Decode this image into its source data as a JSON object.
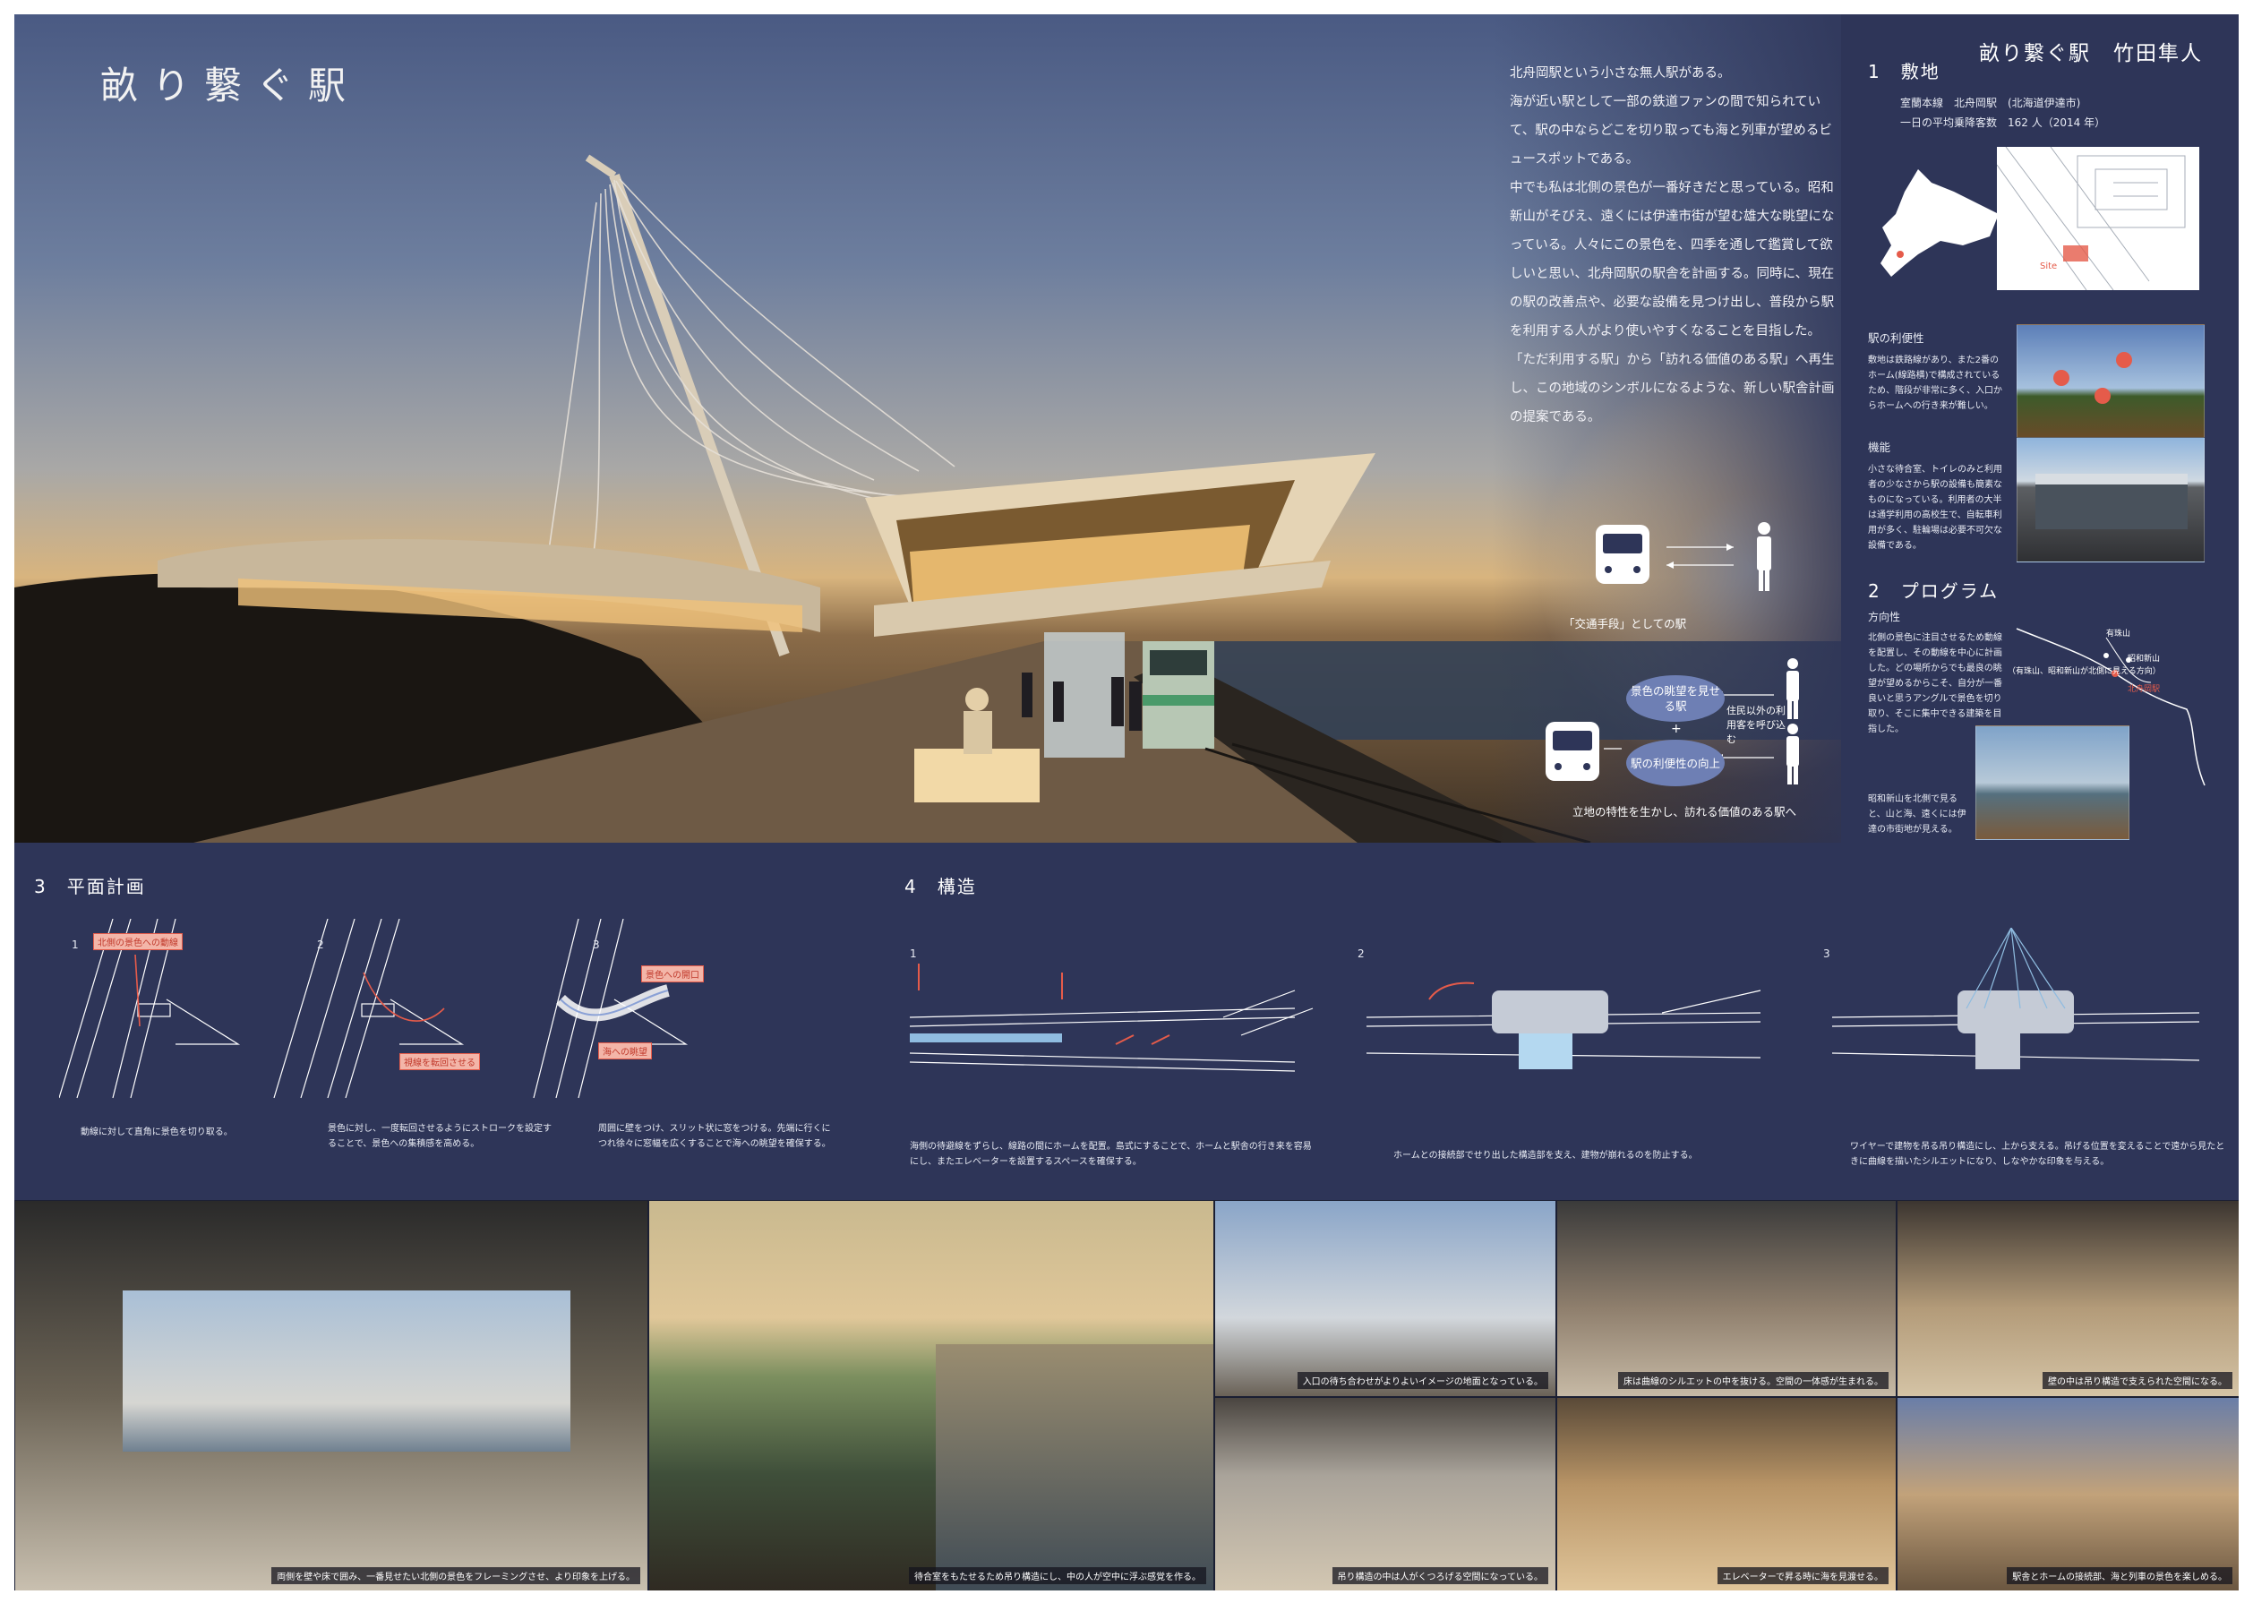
{
  "header": {
    "title": "畝り繋ぐ駅",
    "author": "畝り繋ぐ駅　竹田隼人"
  },
  "intro": {
    "paragraphs": [
      "北舟岡駅という小さな無人駅がある。",
      "海が近い駅として一部の鉄道ファンの間で知られていて、駅の中ならどこを切り取っても海と列車が望めるビュースポットである。",
      "中でも私は北側の景色が一番好きだと思っている。昭和新山がそびえ、遠くには伊達市街が望む雄大な眺望になっている。人々にこの景色を、四季を通して鑑賞して欲しいと思い、北舟岡駅の駅舎を計画する。同時に、現在の駅の改善点や、必要な設備を見つけ出し、普段から駅を利用する人がより使いやすくなることを目指した。",
      "「ただ利用する駅」から「訪れる価値のある駅」へ再生し、この地域のシンボルになるような、新しい駅舎計画の提案である。"
    ]
  },
  "concept": {
    "label_transport": "「交通手段」としての駅",
    "bubble_view": "景色の眺望を見せる駅",
    "plus": "+",
    "bubble_convenience": "駅の利便性の向上",
    "side_label": "住民以外の利用客を呼び込む",
    "footer": "立地の特性を生かし、訪れる価値のある駅へ"
  },
  "site": {
    "heading": "1　敷地",
    "line1": "室蘭本線　北舟岡駅　(北海道伊達市)",
    "line2": "一日の平均乗降客数　162 人（2014 年）",
    "map_label": "Site",
    "convenience_heading": "駅の利便性",
    "convenience_text": "敷地は鉄路線があり、また2番のホーム(線路横)で構成されているため、階段が非常に多く、入口からホームへの行き来が難しい。",
    "function_heading": "機能",
    "function_text": "小さな待合室、トイレのみと利用者の少なさから駅の設備も簡素なものになっている。利用者の大半は通学利用の高校生で、自転車利用が多く、駐輪場は必要不可欠な設備である。"
  },
  "program": {
    "heading": "2　プログラム",
    "sub": "方向性",
    "text": "北側の景色に注目させるため動線を配置し、その動線を中心に計画した。どの場所からでも最良の眺望が望めるからこそ、自分が一番良いと思うアングルで景色を切り取り、そこに集中できる建築を目指した。",
    "text2": "昭和新山を北側で見ると、山と海、遠くには伊達の市街地が見える。",
    "map_tags": [
      "有珠山",
      "昭和新山",
      "北舟岡駅",
      "（有珠山、昭和新山が北側に見える方向）"
    ]
  },
  "plan": {
    "heading": "3　平面計画",
    "steps": [
      {
        "num": "1",
        "tag": "北側の景色への動線",
        "caption": "動線に対して直角に景色を切り取る。"
      },
      {
        "num": "2",
        "tag": "視線を転回させる",
        "caption": "景色に対し、一度転回させるようにストロークを設定することで、景色への集積感を高める。"
      },
      {
        "num": "3",
        "tag": "景色への開口",
        "tag2": "海への眺望",
        "caption": "周囲に壁をつけ、スリット状に窓をつける。先端に行くにつれ徐々に窓幅を広くすることで海への眺望を確保する。"
      }
    ]
  },
  "structure": {
    "heading": "4　構造",
    "steps": [
      {
        "num": "1",
        "caption": "海側の待避線をずらし、線路の間にホームを配置。島式にすることで、ホームと駅舎の行き来を容易にし、またエレベーターを設置するスペースを確保する。"
      },
      {
        "num": "2",
        "caption": "ホームとの接続部でせり出した構造部を支え、建物が崩れるのを防止する。"
      },
      {
        "num": "3",
        "caption": "ワイヤーで建物を吊る吊り構造にし、上から支える。吊げる位置を変えることで遠から見たときに曲線を描いたシルエットになり、しなやかな印象を与える。"
      }
    ]
  },
  "renders": {
    "captions": [
      "両側を壁や床で囲み、一番見せたい北側の景色をフレーミングさせ、より印象を上げる。",
      "待合室をもたせるため吊り構造にし、中の人が空中に浮ぶ感覚を作る。",
      "入口の待ち合わせがよりよいイメージの地面となっている。",
      "床は曲線のシルエットの中を抜ける。空間の一体感が生まれる。",
      "壁の中は吊り構造で支えられた空間になる。",
      "吊り構造の中は人がくつろげる空間になっている。",
      "エレベーターで昇る時に海を見渡せる。",
      "駅舎とホームの接続部、海と列車の景色を楽しめる。"
    ]
  },
  "colors": {
    "board": "#2e3558",
    "accent_red": "#e55b4a",
    "bubble": "#6e7fb4"
  }
}
